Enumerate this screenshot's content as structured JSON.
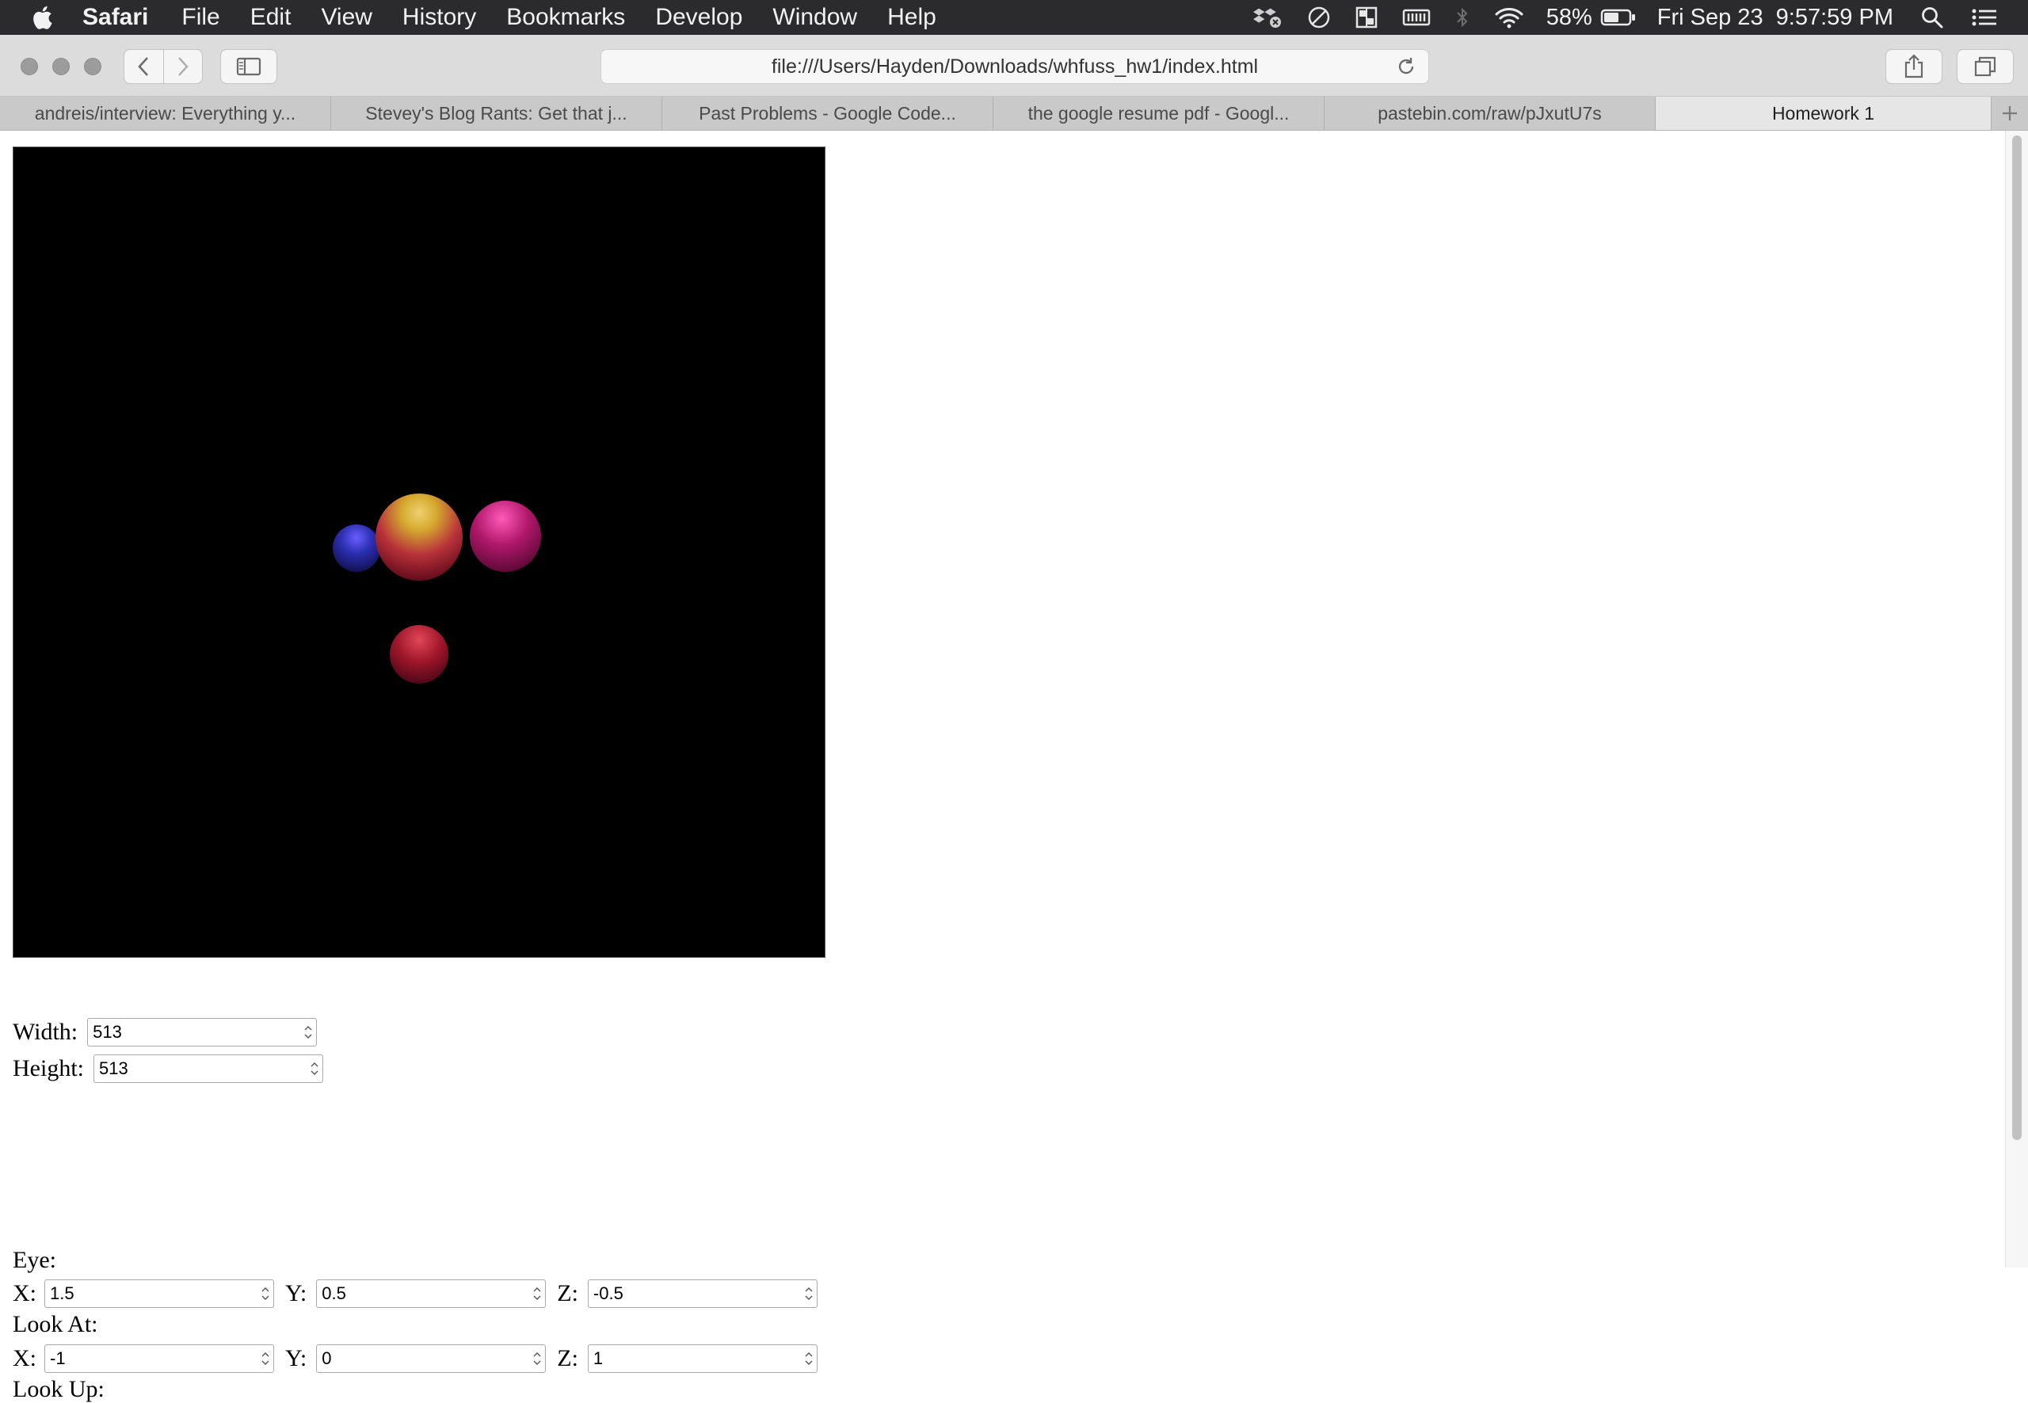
{
  "menubar": {
    "app": "Safari",
    "items": [
      "File",
      "Edit",
      "View",
      "History",
      "Bookmarks",
      "Develop",
      "Window",
      "Help"
    ],
    "battery": "58%",
    "clock": "Fri Sep 23  9:57:59 PM",
    "icons": [
      "dropbox-icon",
      "do-not-disturb-icon",
      "window-manager-icon",
      "memory-icon",
      "bluetooth-icon",
      "wifi-icon",
      "battery-icon",
      "spotlight-search-icon",
      "notification-center-icon"
    ]
  },
  "toolbar": {
    "url": "file:///Users/Hayden/Downloads/whfuss_hw1/index.html"
  },
  "tabs": [
    {
      "label": "andreis/interview: Everything y..."
    },
    {
      "label": "Stevey's Blog Rants: Get that j..."
    },
    {
      "label": "Past Problems - Google Code..."
    },
    {
      "label": "the google resume pdf - Googl..."
    },
    {
      "label": "pastebin.com/raw/pJxutU7s"
    },
    {
      "label": "Homework 1"
    }
  ],
  "form": {
    "width_label": "Width:",
    "width_value": "513",
    "height_label": "Height:",
    "height_value": "513",
    "eye_label": "Eye:",
    "eye": {
      "x_label": "X:",
      "x": "1.5",
      "y_label": "Y:",
      "y": "0.5",
      "z_label": "Z:",
      "z": "-0.5"
    },
    "lookat_label": "Look At:",
    "lookat": {
      "x_label": "X:",
      "x": "-1",
      "y_label": "Y:",
      "y": "0",
      "z_label": "Z:",
      "z": "1"
    },
    "lookup_label": "Look Up:"
  },
  "colors": {
    "menubar_bg": "#2b2b2d",
    "canvas_bg": "#000000",
    "sphere_gold": "#d4a92e",
    "sphere_red": "#a0162a",
    "sphere_magenta": "#b0186a",
    "sphere_blue": "#2c2fb0"
  }
}
